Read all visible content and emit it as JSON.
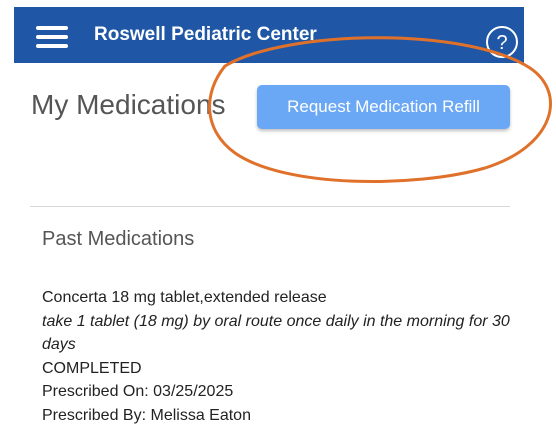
{
  "header": {
    "title": "Roswell Pediatric Center",
    "menu_icon": "hamburger-menu-icon",
    "help_icon": "question-circle-icon",
    "bg_color": "#1f57a6"
  },
  "page": {
    "title": "My Medications",
    "refill_button_label": "Request Medication Refill",
    "refill_button_color": "#6aa7f5",
    "annotation_color": "#e0712b"
  },
  "past_medications": {
    "section_title": "Past Medications",
    "items": [
      {
        "name": "Concerta 18 mg tablet,extended release",
        "sig": "take 1 tablet (18 mg) by oral route once daily in the morning for 30 days",
        "status": "COMPLETED",
        "prescribed_on": "Prescribed On: 03/25/2025",
        "prescribed_by": "Prescribed By: Melissa Eaton"
      }
    ]
  }
}
